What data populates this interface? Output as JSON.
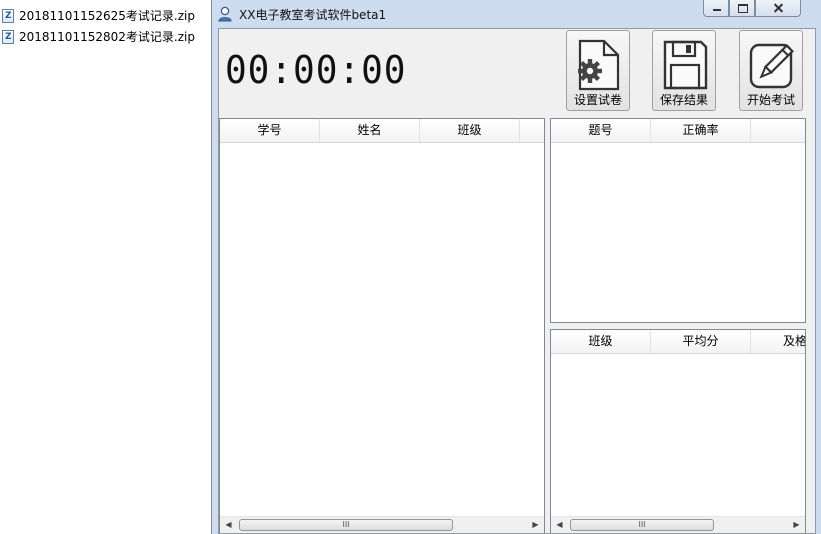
{
  "explorer": {
    "files": [
      {
        "name": "20181101152625考试记录.zip"
      },
      {
        "name": "20181101152802考试记录.zip"
      }
    ]
  },
  "window": {
    "title": "XX电子教室考试软件beta1"
  },
  "timer": {
    "display": "00:00:00"
  },
  "toolbar": {
    "setup_label": "设置试卷",
    "save_label": "保存结果",
    "start_label": "开始考试"
  },
  "students_table": {
    "columns": [
      "学号",
      "姓名",
      "班级"
    ],
    "rows": []
  },
  "questions_table": {
    "columns": [
      "题号",
      "正确率"
    ],
    "rows": []
  },
  "class_table": {
    "columns": [
      "班级",
      "平均分",
      "及格"
    ],
    "rows": []
  },
  "scrollbar": {
    "grip": "III"
  },
  "colors": {
    "window_frame": "#cddcee",
    "client_bg": "#f0f0f0"
  }
}
